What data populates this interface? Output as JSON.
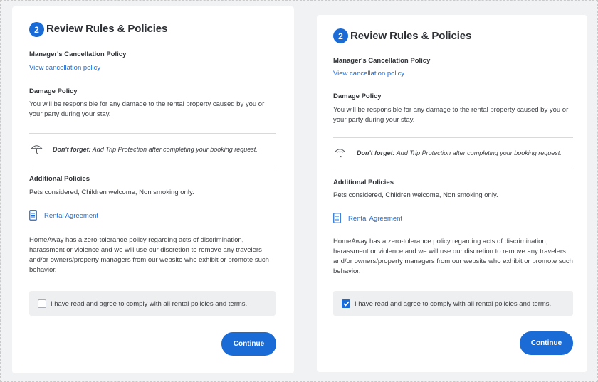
{
  "panels": [
    {
      "step_number": "2",
      "title": "Review Rules & Policies",
      "cancellation_label": "Manager's Cancellation Policy",
      "cancellation_link": "View cancellation policy",
      "damage_label": "Damage Policy",
      "damage_line1": "You will be responsible for any damage to the rental property caused by you or",
      "damage_line2": "your party during your stay.",
      "dont_forget_bold": "Don't forget:",
      "dont_forget_text": " Add Trip Protection after completing your booking request.",
      "additional_label": "Additional Policies",
      "additional_text": "Pets considered, Children welcome, Non smoking only.",
      "rental_agreement_link": "Rental Agreement",
      "policy_line1": "HomeAway has a zero-tolerance policy regarding acts of discrimination,",
      "policy_line2": "harassment or violence and we will use our discretion to remove any travelers",
      "policy_line3": "and/or owners/property managers from our website who exhibit or promote such",
      "policy_line4": "behavior.",
      "agree_text": "I have read and agree to comply with all rental policies and terms.",
      "agree_checked": false,
      "continue_label": "Continue"
    },
    {
      "step_number": "2",
      "title": "Review Rules & Policies",
      "cancellation_label": "Manager's Cancellation Policy",
      "cancellation_link": "View cancellation policy.",
      "damage_label": "Damage Policy",
      "damage_line1": "You will be responsible for any damage to the rental property caused by you or",
      "damage_line2": "your party during your stay.",
      "dont_forget_bold": "Don't forget:",
      "dont_forget_text": " Add Trip Protection after completing your booking request.",
      "additional_label": "Additional Policies",
      "additional_text": "Pets considered, Children welcome, Non smoking only.",
      "rental_agreement_link": "Rental Agreement",
      "policy_line1": "HomeAway has a zero-tolerance policy regarding acts of discrimination,",
      "policy_line2": "harassment or violence and we will use our discretion to remove any travelers",
      "policy_line3": "and/or owners/property managers from our website who exhibit or promote such",
      "policy_line4": "behavior.",
      "agree_text": "I have read and agree to comply with all rental policies and terms.",
      "agree_checked": true,
      "continue_label": "Continue"
    }
  ],
  "colors": {
    "accent": "#1a6bd6",
    "background": "#f1f2f4",
    "agree_box": "#eeeff1"
  },
  "icons": {
    "umbrella": "umbrella-icon",
    "document": "document-icon",
    "check": "check-icon"
  }
}
